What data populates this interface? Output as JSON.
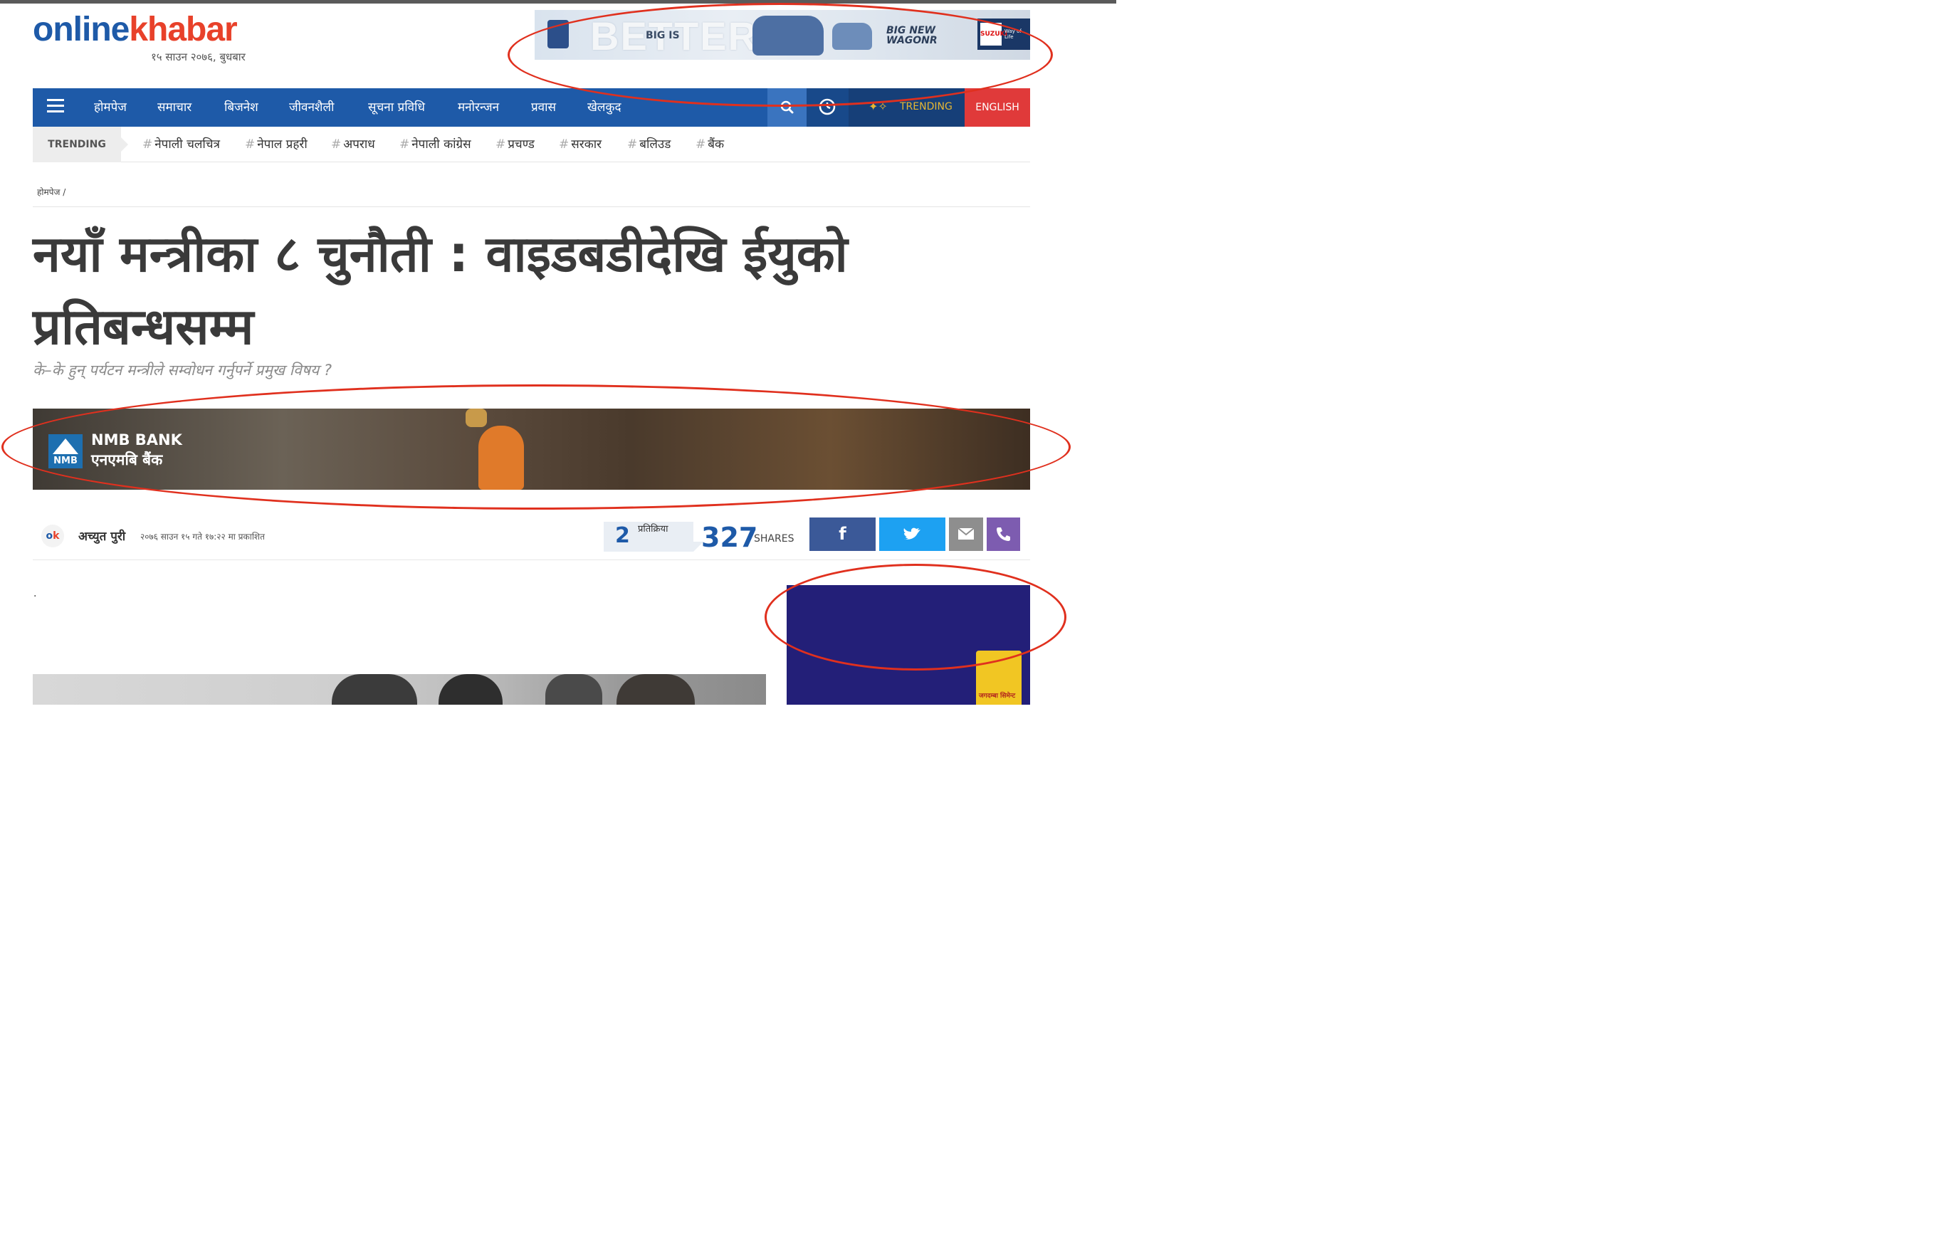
{
  "site": {
    "logo_part1": "online",
    "logo_part2": "khabar",
    "date": "१५ साउन २०७६, बुधबार"
  },
  "top_ad": {
    "word1": "BETTER",
    "word2": "BIG IS",
    "word3": "BIG NEW WAGONR",
    "brand": "SUZUKI",
    "tagline": "Way of Life"
  },
  "nav": {
    "items": [
      "होमपेज",
      "समाचार",
      "बिजनेश",
      "जीवनशैली",
      "सूचना प्रविधि",
      "मनोरन्जन",
      "प्रवास",
      "खेलकुद"
    ],
    "trending_label": "TRENDING",
    "english_label": "ENGLISH"
  },
  "trending": {
    "label": "TRENDING",
    "tags": [
      "नेपाली चलचित्र",
      "नेपाल प्रहरी",
      "अपराध",
      "नेपाली कांग्रेस",
      "प्रचण्ड",
      "सरकार",
      "बलिउड",
      "बैंक"
    ]
  },
  "breadcrumb": "होमपेज /",
  "article": {
    "headline": "नयाँ मन्त्रीका ८ चुनौती : वाइडबडीदेखि ईयुको प्रतिबन्धसम्म",
    "subheadline": "के–के हुन् पर्यटन मन्त्रीले सम्वोधन गर्नुपर्ने प्रमुख विषय ?",
    "author": "अच्युत पुरी",
    "published": "२०७६ साउन १५ गते १७:२२ मा प्रकाशित",
    "comments_count": "2",
    "comments_label": "प्रतिक्रिया",
    "shares_count": "327",
    "shares_label": "SHARES",
    "body_start": "."
  },
  "nmb_ad": {
    "name_en": "NMB BANK",
    "name_ne": "एनएमबि बैंक",
    "logo_text": "NMB"
  },
  "side_ad": {
    "product_text": "जगदम्बा सिमेन्ट"
  },
  "icons": {
    "menu": "menu-icon",
    "search": "search-icon",
    "clock": "clock-icon",
    "trending": "trending-icon",
    "facebook": "facebook-icon",
    "twitter": "twitter-icon",
    "email": "email-icon",
    "viber": "viber-icon"
  },
  "colors": {
    "brand_blue": "#1e5aa8",
    "brand_red": "#e8412a",
    "english_btn": "#e03a3a",
    "trending_gold": "#e6b733",
    "annotation": "#e0301e"
  }
}
